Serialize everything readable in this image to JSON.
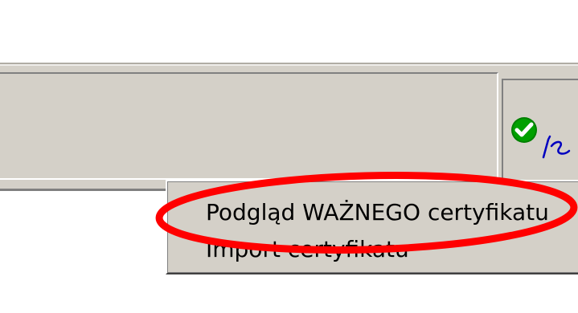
{
  "status_bar": {
    "tray_icons": [
      {
        "icon": "green-check-icon",
        "color": "#00a000"
      },
      {
        "icon": "signature-icon",
        "color": "#0000c0"
      }
    ]
  },
  "context_menu": {
    "items": [
      {
        "label": "Podgląd WAŻNEGO certyfikatu"
      },
      {
        "label": "Import certyfikatu"
      }
    ]
  },
  "annotation": {
    "shape": "ellipse",
    "color": "#ff0000"
  }
}
